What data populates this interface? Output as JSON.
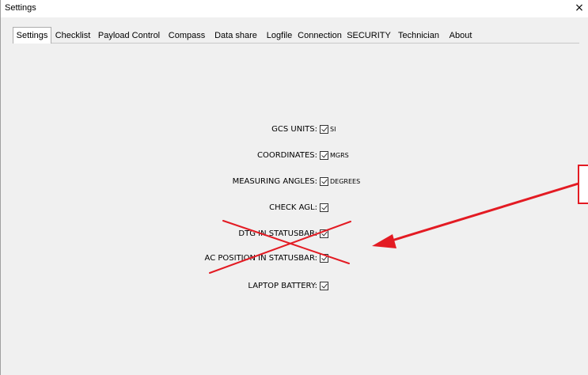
{
  "window": {
    "title": "Settings",
    "close_glyph": "×"
  },
  "tabs": [
    {
      "label": "Settings",
      "active": true
    },
    {
      "label": "Checklist"
    },
    {
      "label": "Payload Control"
    },
    {
      "label": "Compass"
    },
    {
      "label": "Data share"
    },
    {
      "label": "Logfile"
    },
    {
      "label": "Connection"
    },
    {
      "label": "SECURITY"
    },
    {
      "label": "Technician"
    },
    {
      "label": "About"
    }
  ],
  "settings": [
    {
      "label": "GCS UNITS:",
      "checked": true,
      "value": "SI"
    },
    {
      "label": "COORDINATES:",
      "checked": true,
      "value": "MGRS"
    },
    {
      "label": "MEASURING ANGLES:",
      "checked": true,
      "value": "DEGREES"
    },
    {
      "label": "CHECK AGL:",
      "checked": true,
      "value": ""
    },
    {
      "label": "DTG IN STATUSBAR:",
      "checked": true,
      "value": ""
    },
    {
      "label": "AC POSITION IN STATUSBAR:",
      "checked": true,
      "value": ""
    },
    {
      "label": "LAPTOP BATTERY:",
      "checked": true,
      "value": ""
    }
  ],
  "annotation": {
    "color": "#e31b23",
    "cross_icon": "red-x-icon",
    "arrow_icon": "red-arrow-icon"
  }
}
